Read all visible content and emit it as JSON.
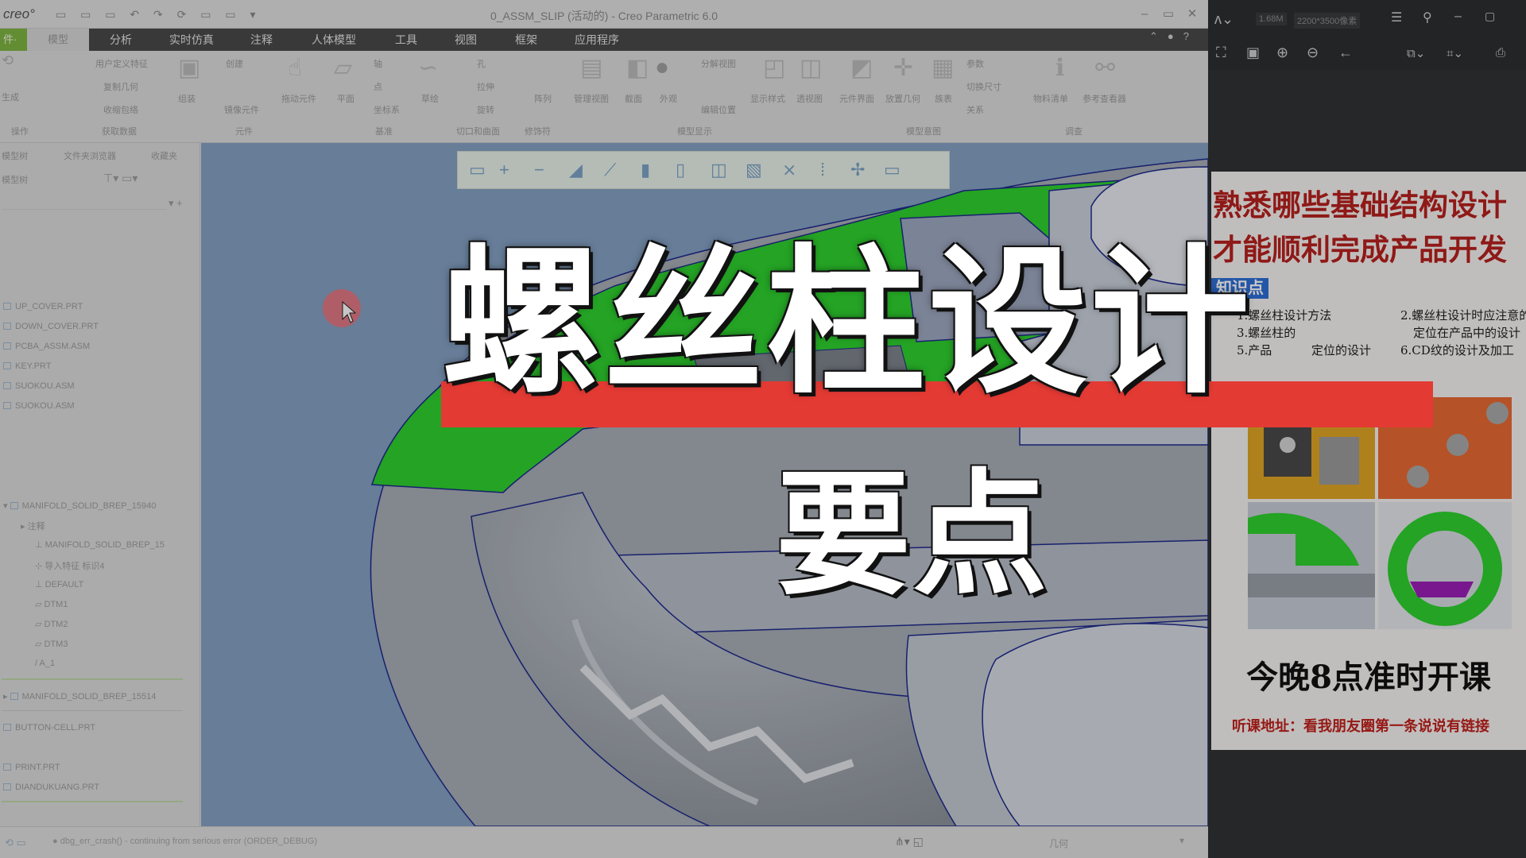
{
  "window": {
    "title": "0_ASSM_SLIP (活动的) - Creo Parametric 6.0",
    "logo": "creo°"
  },
  "ribbon": {
    "file_tab": "件·",
    "model_tab": "模型",
    "tabs": [
      "分析",
      "实时仿真",
      "注释",
      "人体模型",
      "工具",
      "视图",
      "框架",
      "应用程序"
    ],
    "items": [
      "用户定义特征",
      "复制几何",
      "收缩包络",
      "组装",
      "创建",
      "镜像元件",
      "拖动元件",
      "平面",
      "轴",
      "点",
      "坐标系",
      "草绘",
      "孔",
      "拉伸",
      "旋转",
      "阵列",
      "管理视图",
      "截面",
      "外观",
      "分解视图",
      "编辑位置",
      "显示样式",
      "透视图",
      "元件界面",
      "放置几何",
      "参数",
      "切换尺寸",
      "关系",
      "物料清单",
      "参考查看器",
      "族表",
      "生成"
    ],
    "groups": [
      "操作",
      "获取数据",
      "元件",
      "基准",
      "切口和曲面",
      "修饰符",
      "模型显示",
      "模型意图",
      "调查"
    ]
  },
  "left_panel": {
    "tabs": [
      "模型树",
      "文件夹浏览器",
      "收藏夹"
    ],
    "tree_label": "模型树",
    "items": [
      "UP_COVER.PRT",
      "DOWN_COVER.PRT",
      "PCBA_ASSM.ASM",
      "KEY.PRT",
      "SUOKOU.ASM",
      "SUOKOU.ASM"
    ],
    "manifold_1": "MANIFOLD_SOLID_BREP_15940",
    "sub_items": [
      "注释",
      "MANIFOLD_SOLID_BREP_15",
      "导入特征 标识4",
      "DEFAULT",
      "DTM1",
      "DTM2",
      "DTM3",
      "A_1"
    ],
    "manifold_2": "MANIFOLD_SOLID_BREP_15514",
    "bottom_items": [
      "BUTTON-CELL.PRT",
      "PRINT.PRT",
      "DIANDUKUANG.PRT"
    ]
  },
  "status": {
    "message": "dbg_err_crash() - continuing from serious error (ORDER_DEBUG)",
    "filter_label": "几何"
  },
  "viewer": {
    "size": "1.68M",
    "resolution": "2200*3500像素"
  },
  "poster": {
    "title_line1": "熟悉哪些基础结构设计",
    "title_line2": "才能顺利完成产品开发",
    "knowledge_label": "知识点",
    "points": [
      "1.螺丝柱设计方法",
      "2.螺丝柱设计时应注意的",
      "3.螺丝柱的",
      "定位在产品中的设计",
      "5.产品",
      "定位的设计",
      "6.CD纹的设计及加工"
    ],
    "tonight": "今晚8点准时开课",
    "address": "听课地址：看我朋友圈第一条说说有链接"
  },
  "overlay": {
    "title": "螺丝柱设计",
    "subtitle": "要点"
  },
  "colors": {
    "accent_green": "#2fd12f",
    "brand_red": "#e43a34",
    "creo_green": "#7fb542",
    "poster_red": "#b8211e"
  }
}
